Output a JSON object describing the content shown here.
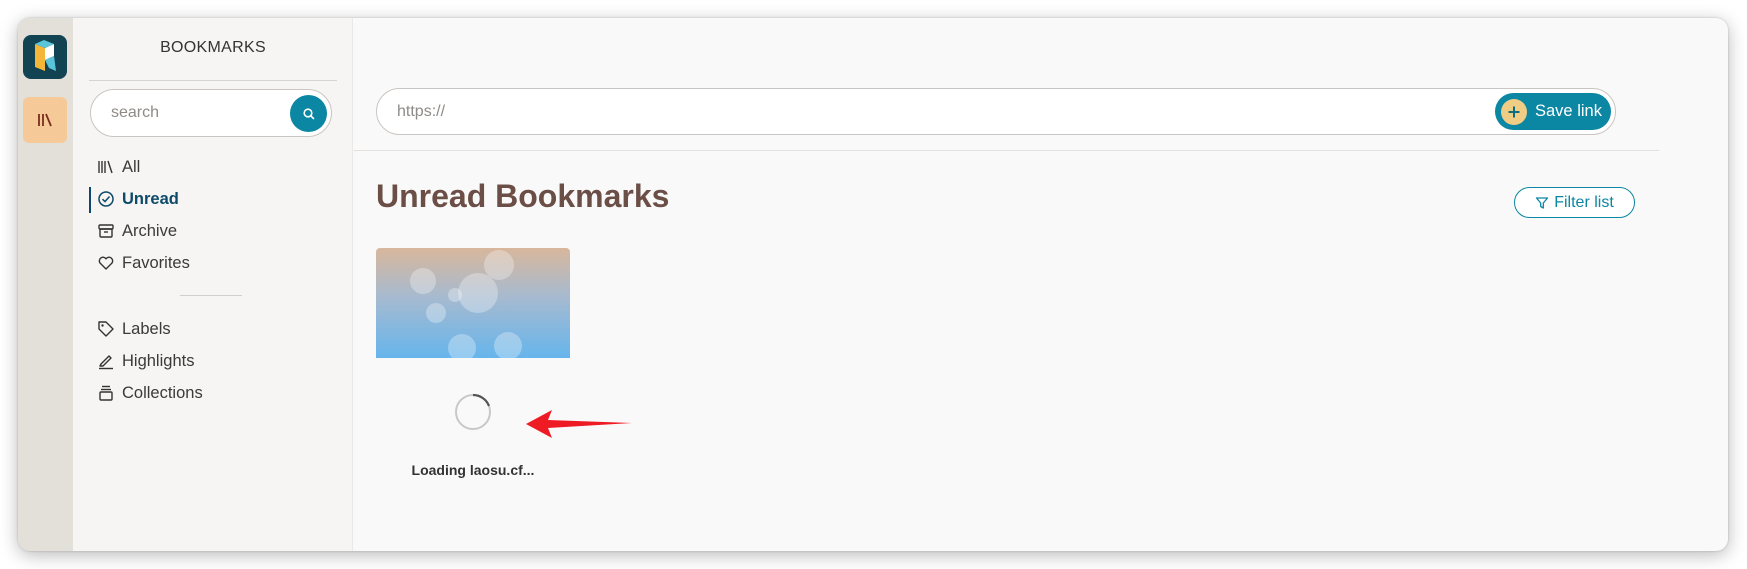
{
  "sidebar": {
    "title": "BOOKMARKS",
    "search_placeholder": "search",
    "nav_main": [
      {
        "label": "All",
        "icon": "library-icon"
      },
      {
        "label": "Unread",
        "icon": "check-circle-icon",
        "active": true
      },
      {
        "label": "Archive",
        "icon": "archive-box-icon"
      },
      {
        "label": "Favorites",
        "icon": "heart-icon"
      }
    ],
    "nav_secondary": [
      {
        "label": "Labels",
        "icon": "tag-icon"
      },
      {
        "label": "Highlights",
        "icon": "highlighter-icon"
      },
      {
        "label": "Collections",
        "icon": "collections-icon"
      }
    ]
  },
  "main": {
    "url_placeholder": "https://",
    "save_label": "Save link",
    "page_title": "Unread Bookmarks",
    "filter_label": "Filter list",
    "cards": [
      {
        "status_text": "Loading laosu.cf..."
      }
    ]
  },
  "colors": {
    "accent": "#0b86a3",
    "title": "#6b4f47",
    "rail": "#e3dfd9",
    "rail_active": "#f5c998",
    "arrow": "#ee1b24"
  }
}
